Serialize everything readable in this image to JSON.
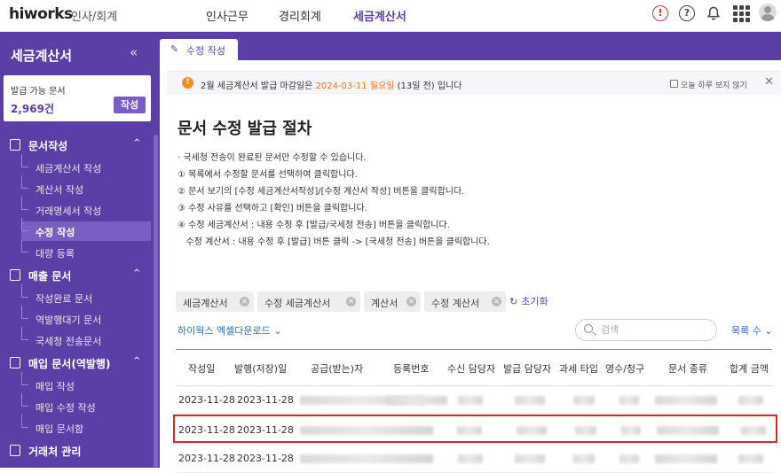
{
  "topbar": {
    "logo": "hiworks",
    "logo_sub": "인사/회계",
    "nav": [
      "인사근무",
      "경리회계",
      "세금계산서"
    ],
    "active_nav": "세금계산서"
  },
  "sidebar": {
    "title": "세금계산서",
    "collapse": "«",
    "card": {
      "label": "발급 가능 문서",
      "count": "2,969건",
      "button": "작성"
    },
    "groups": [
      {
        "label": "문서작성",
        "chevron": "^",
        "items": [
          "세금계산서 작성",
          "계산서 작성",
          "거래명세서 작성",
          "수정 작성",
          "대량 등록"
        ]
      },
      {
        "label": "매출 문서",
        "chevron": "^",
        "items": [
          "작성완료 문서",
          "역발행대기 문서",
          "국세청 전송문서"
        ]
      },
      {
        "label": "매입 문서(역발행)",
        "chevron": "^",
        "items": [
          "매입 작성",
          "매입 수정 작성",
          "매입 문서함"
        ]
      },
      {
        "label": "거래처 관리",
        "chevron": "",
        "items": []
      }
    ],
    "active_item": "수정 작성"
  },
  "tab": {
    "label": "수정 작성"
  },
  "notice": {
    "prefix": "2월 세금계산서 발급 마감일은 ",
    "date": "2024-03-11 월요일",
    "suffix": " (13일 전) 입니다",
    "checkbox_label": "오늘 하루 보지 않기",
    "close": "✕"
  },
  "main": {
    "title": "문서 수정 발급 절차",
    "instructions": [
      "· 국세청 전송이 완료된 문서만 수정할 수 있습니다.",
      "① 목록에서 수정할 문서를 선택하여 클릭합니다.",
      "② 문서 보기의 [수정 세금계산서작성]/[수정 계산서 작성] 버튼을 클릭합니다.",
      "③ 수정 사유를 선택하고 [확인] 버튼을 클릭합니다.",
      "④ 수정 세금계산서 : 내용 수정 후 [발급/국세청 전송] 버튼을 클릭합니다.",
      "   수정 계산서 : 내용 수정 후 [발급] 버튼 클릭 -> [국세청 전송] 버튼을 클릭합니다."
    ],
    "filters": [
      "세금계산서",
      "수정 세금계산서",
      "계산서",
      "수정 계산서"
    ],
    "reset_label": "초기화",
    "excel_label": "하이웍스 엑셀다운로드",
    "search_placeholder": "검색",
    "rowcount_label": "목록 수"
  },
  "table": {
    "columns": [
      "작성일",
      "발행(저장)일",
      "공급(받는)자",
      "등록번호",
      "수신 담당자",
      "발급 담당자",
      "과세 타입",
      "영수/청구",
      "문서 종류",
      "합계 금액"
    ],
    "rows": [
      {
        "written": "2023-11-28",
        "issued": "2023-11-28"
      },
      {
        "written": "2023-11-28",
        "issued": "2023-11-28"
      },
      {
        "written": "2023-11-28",
        "issued": "2023-11-28"
      }
    ],
    "highlighted_row": 1
  },
  "colors": {
    "brand": "#5b3fa6",
    "highlight": "#d42a2a",
    "notice_date": "#e4771c",
    "link": "#2f6dbe"
  }
}
